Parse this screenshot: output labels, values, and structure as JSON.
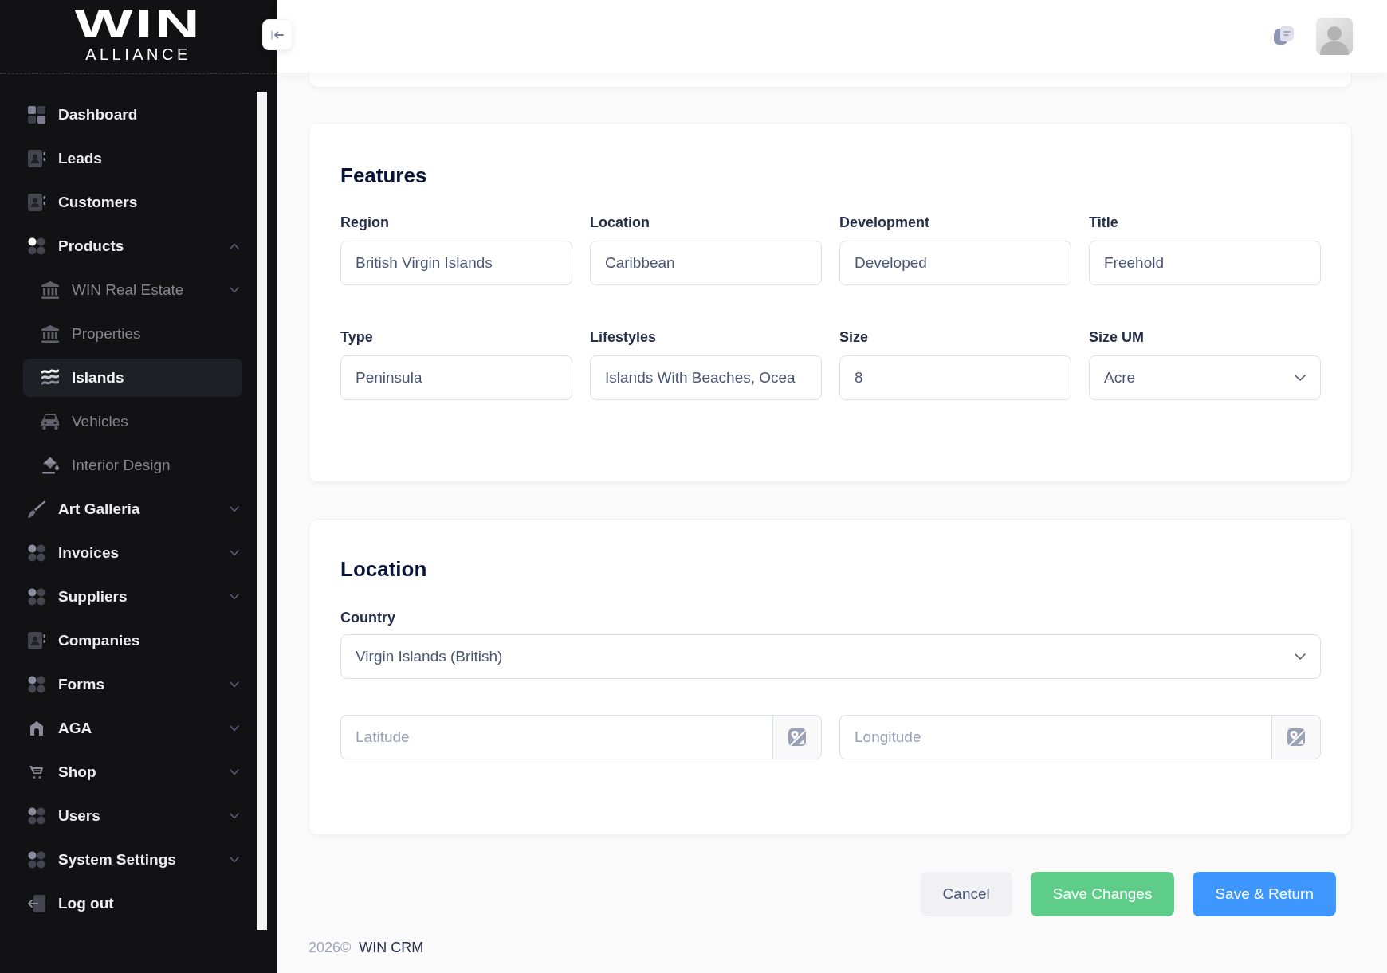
{
  "sidebar": {
    "logo": {
      "wordmark": "WIN",
      "tagline": "ALLIANCE"
    },
    "items": [
      {
        "label": "Dashboard",
        "selected": false
      },
      {
        "label": "Leads",
        "selected": false
      },
      {
        "label": "Customers",
        "selected": false
      },
      {
        "label": "Products",
        "selected": false,
        "expanded": true,
        "children": [
          {
            "label": "WIN Real Estate",
            "selected": false,
            "expanded": false
          },
          {
            "label": "Properties",
            "selected": false
          },
          {
            "label": "Islands",
            "selected": true
          },
          {
            "label": "Vehicles",
            "selected": false
          },
          {
            "label": "Interior Design",
            "selected": false
          }
        ]
      },
      {
        "label": "Art Galleria",
        "selected": false,
        "expanded": false
      },
      {
        "label": "Invoices",
        "selected": false,
        "expanded": false
      },
      {
        "label": "Suppliers",
        "selected": false,
        "expanded": false
      },
      {
        "label": "Companies",
        "selected": false
      },
      {
        "label": "Forms",
        "selected": false,
        "expanded": false
      },
      {
        "label": "AGA",
        "selected": false,
        "expanded": false
      },
      {
        "label": "Shop",
        "selected": false,
        "expanded": false
      },
      {
        "label": "Users",
        "selected": false,
        "expanded": false
      },
      {
        "label": "System Settings",
        "selected": false,
        "expanded": false
      },
      {
        "label": "Log out",
        "selected": false
      }
    ]
  },
  "features": {
    "title": "Features",
    "fields": [
      {
        "label": "Region",
        "value": "British Virgin Islands",
        "kind": "text"
      },
      {
        "label": "Location",
        "value": "Caribbean",
        "kind": "text"
      },
      {
        "label": "Development",
        "value": "Developed",
        "kind": "text"
      },
      {
        "label": "Title",
        "value": "Freehold",
        "kind": "text"
      },
      {
        "label": "Type",
        "value": "Peninsula",
        "kind": "text"
      },
      {
        "label": "Lifestyles",
        "value": "Islands With Beaches, Ocea",
        "kind": "text"
      },
      {
        "label": "Size",
        "value": "8",
        "kind": "text"
      },
      {
        "label": "Size UM",
        "value": "Acre",
        "kind": "select"
      }
    ]
  },
  "location": {
    "title": "Location",
    "country": {
      "label": "Country",
      "value": "Virgin Islands (British)",
      "kind": "select"
    },
    "coordinates": [
      {
        "placeholder": "Latitude"
      },
      {
        "placeholder": "Longitude"
      }
    ]
  },
  "actions": [
    {
      "label": "Cancel",
      "kind": "secondary"
    },
    {
      "label": "Save Changes",
      "kind": "success"
    },
    {
      "label": "Save & Return",
      "kind": "primary"
    }
  ],
  "footer": {
    "year": "2026©",
    "brand": "WIN CRM"
  }
}
